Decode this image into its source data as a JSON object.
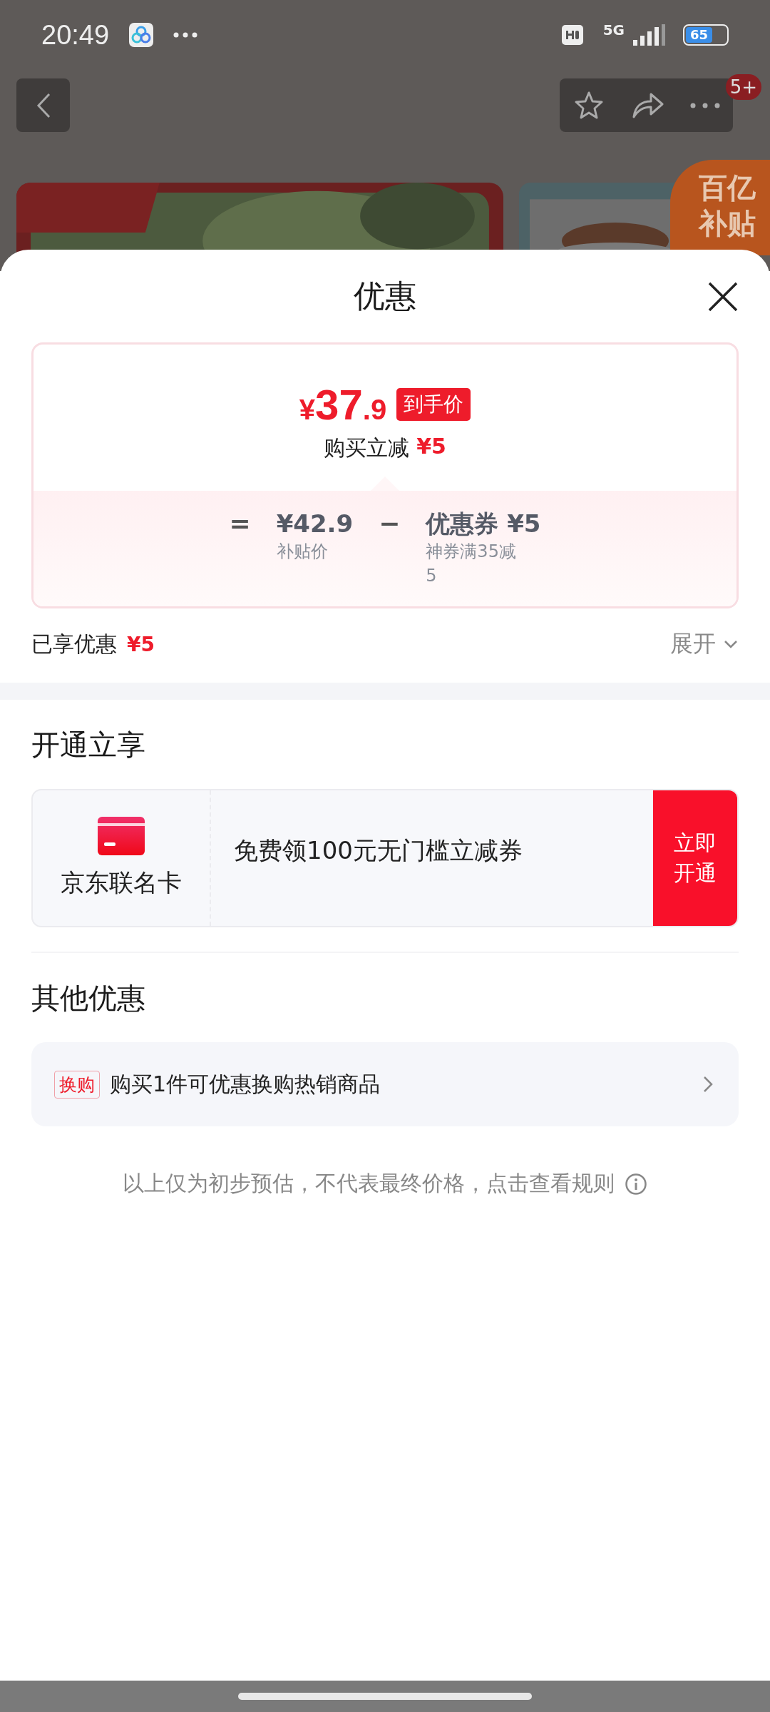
{
  "status_bar": {
    "time": "20:49",
    "network": "5G",
    "battery": "65"
  },
  "nav": {
    "badge": "5+"
  },
  "background": {
    "promo_badge": "百亿补贴"
  },
  "sheet": {
    "title": "优惠",
    "price_card": {
      "currency": "¥",
      "price_int": "37",
      "price_dec": ".9",
      "price_tag": "到手价",
      "instant_label": "购买立减",
      "instant_amount": "¥5",
      "formula": [
        {
          "kind": "op",
          "text": "="
        },
        {
          "kind": "term",
          "value": "¥42.9",
          "caption": "补贴价"
        },
        {
          "kind": "op",
          "text": "−"
        },
        {
          "kind": "term",
          "value": "优惠券 ¥5",
          "caption": "神券满35减5"
        }
      ]
    },
    "enjoyed": {
      "label": "已享优惠",
      "amount": "¥5",
      "toggle": "展开",
      "expanded": false
    },
    "open_section": {
      "title": "开通立享",
      "card_name": "京东联名卡",
      "offer": "免费领100元无门槛立减券",
      "button": "立即开通"
    },
    "other_section": {
      "title": "其他优惠",
      "items": [
        {
          "tag": "换购",
          "text": "购买1件可优惠换购热销商品"
        }
      ]
    },
    "note": "以上仅为初步预估，不代表最终价格，点击查看规则"
  }
}
